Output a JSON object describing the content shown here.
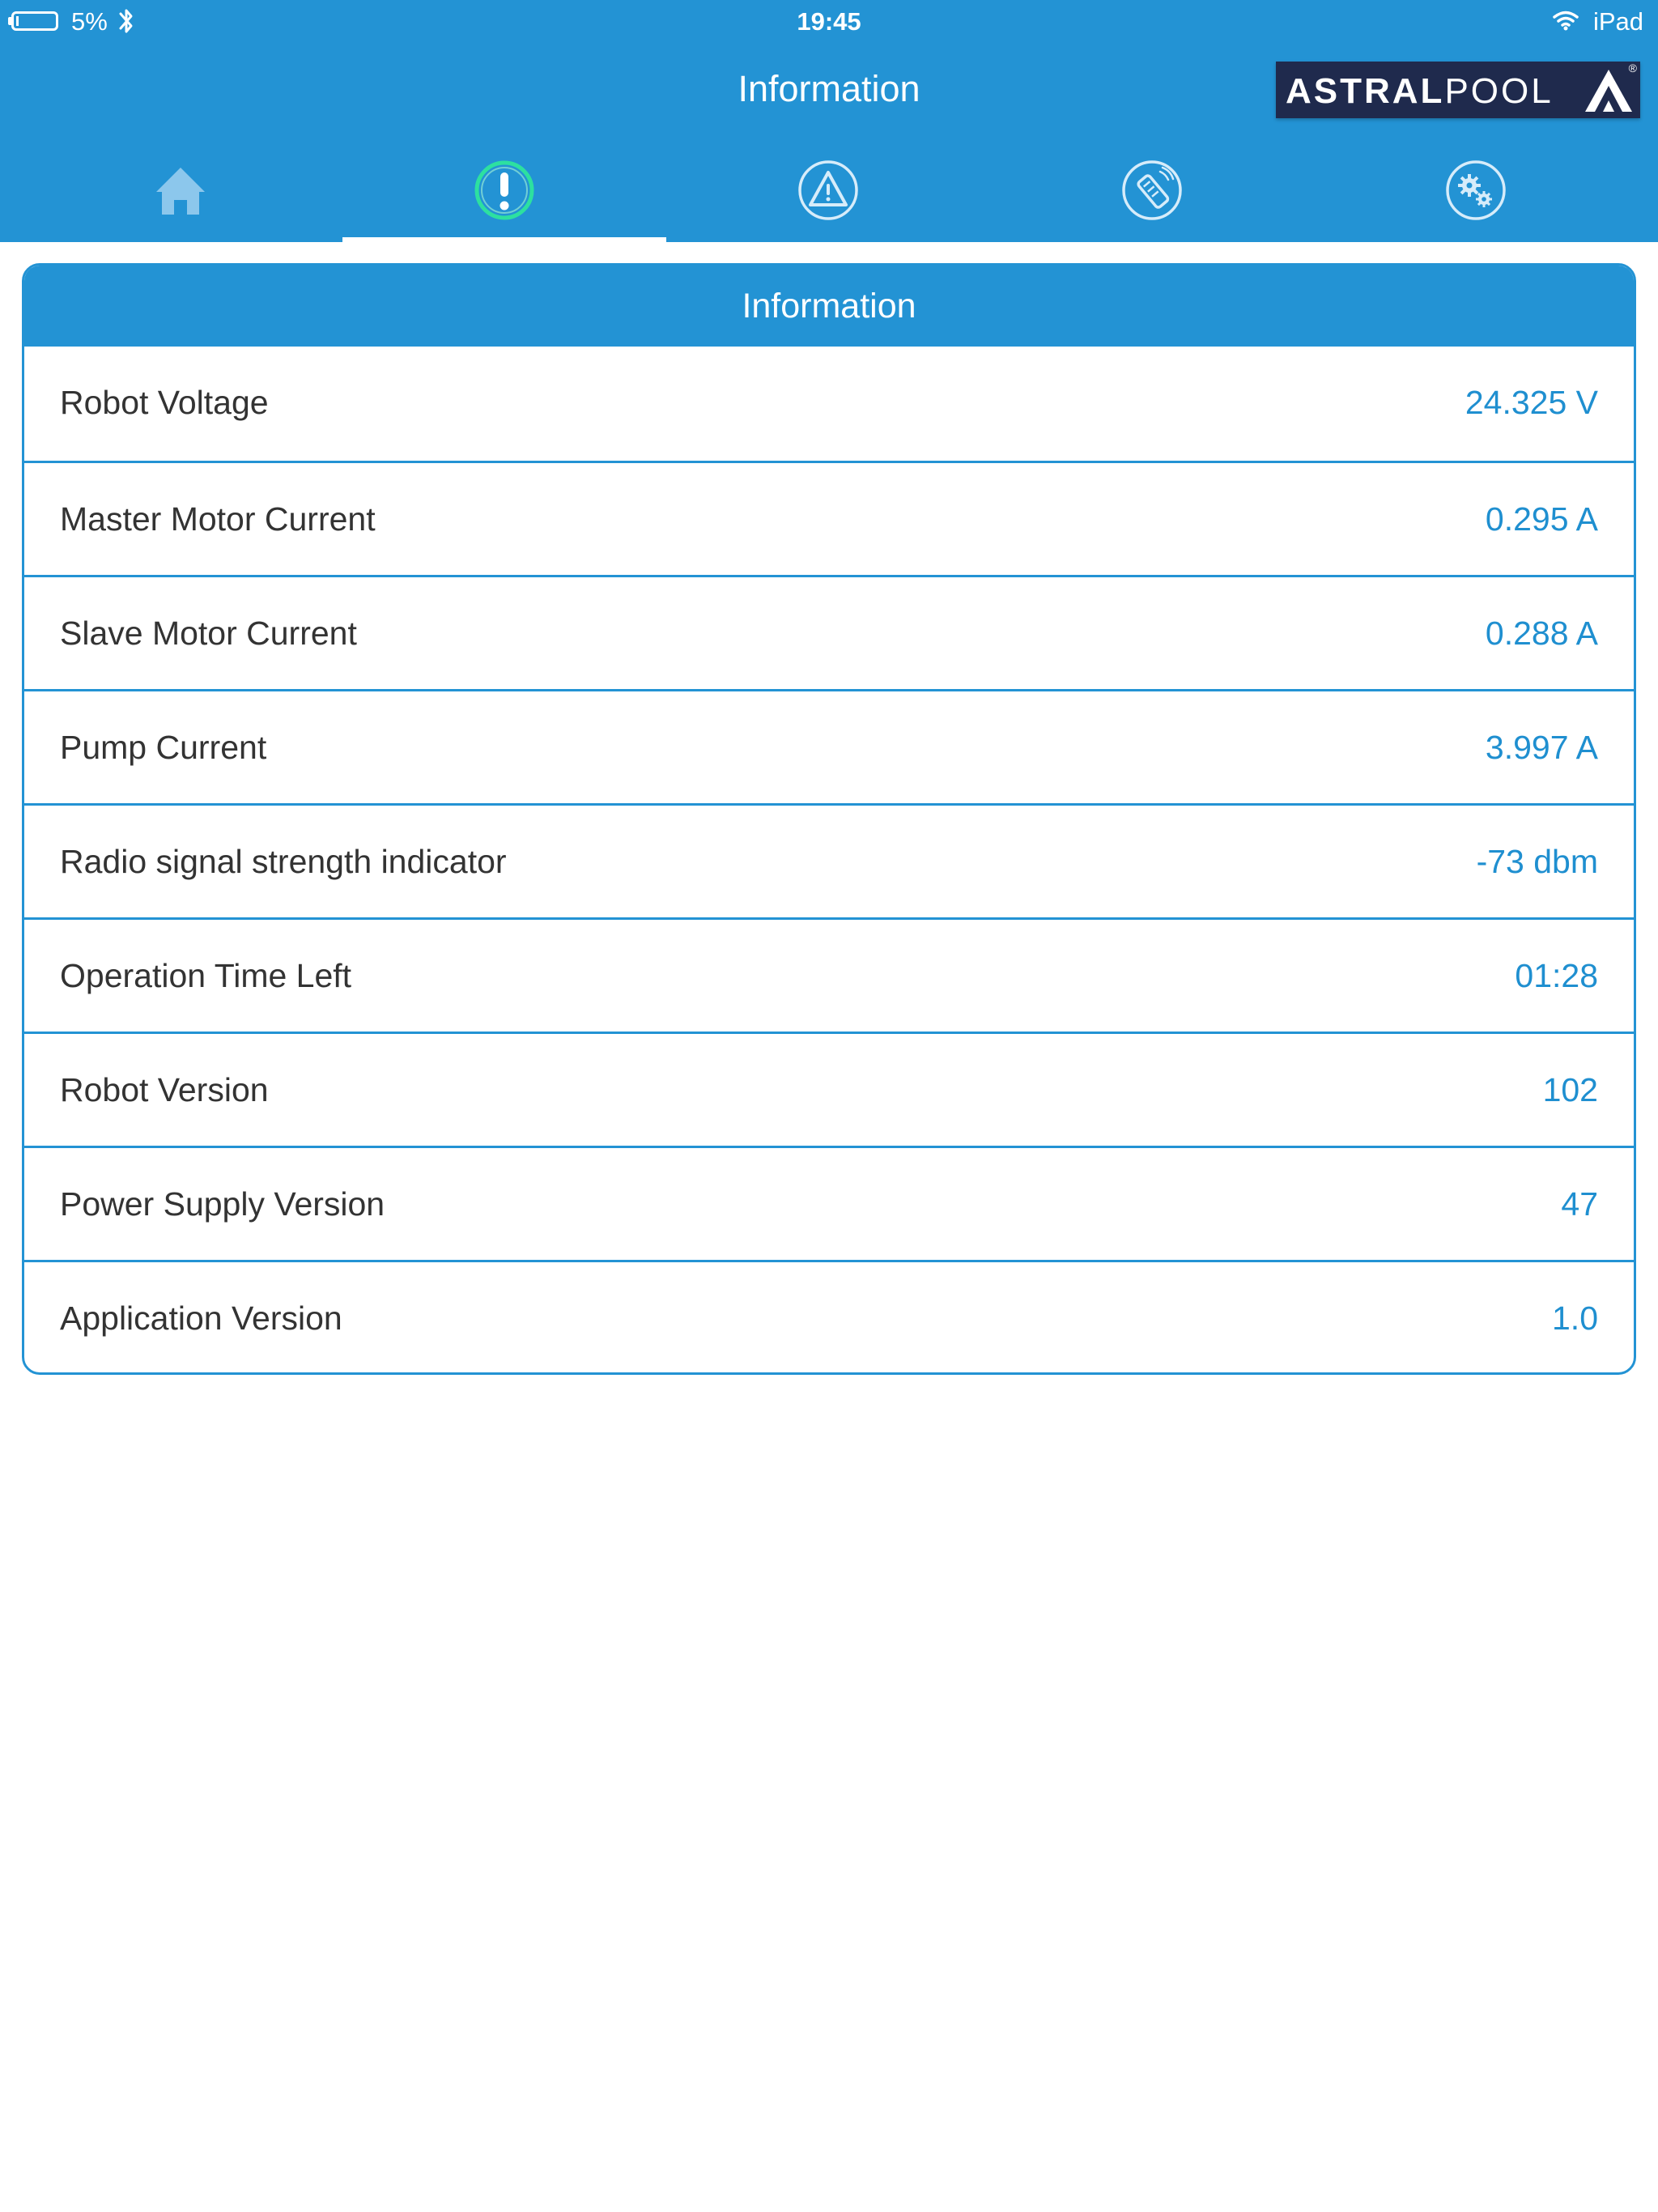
{
  "status_bar": {
    "battery": "5%",
    "time": "19:45",
    "device": "iPad"
  },
  "header": {
    "title": "Information",
    "brand": {
      "bold": "ASTRAL",
      "light": "POOL",
      "reg": "®"
    }
  },
  "nav": {
    "tabs": [
      {
        "name": "home",
        "icon": "home-icon",
        "active": false
      },
      {
        "name": "information",
        "icon": "exclamation-circle-icon",
        "active": true
      },
      {
        "name": "warnings",
        "icon": "warning-triangle-icon",
        "active": false
      },
      {
        "name": "remote",
        "icon": "remote-control-icon",
        "active": false
      },
      {
        "name": "settings",
        "icon": "gears-icon",
        "active": false
      }
    ]
  },
  "card": {
    "title": "Information",
    "rows": [
      {
        "label": "Robot Voltage",
        "value": "24.325 V"
      },
      {
        "label": "Master Motor Current",
        "value": "0.295 A"
      },
      {
        "label": "Slave Motor Current",
        "value": "0.288 A"
      },
      {
        "label": "Pump Current",
        "value": "3.997 A"
      },
      {
        "label": "Radio signal strength indicator",
        "value": "-73 dbm"
      },
      {
        "label": "Operation Time Left",
        "value": "01:28"
      },
      {
        "label": "Robot Version",
        "value": "102"
      },
      {
        "label": "Power Supply Version",
        "value": "47"
      },
      {
        "label": "Application Version",
        "value": "1.0"
      }
    ]
  },
  "colors": {
    "primary": "#2393d4",
    "value_text": "#1f8fd0",
    "active_icon": "#2de0a0",
    "brand_bg": "#1f2a4d"
  }
}
